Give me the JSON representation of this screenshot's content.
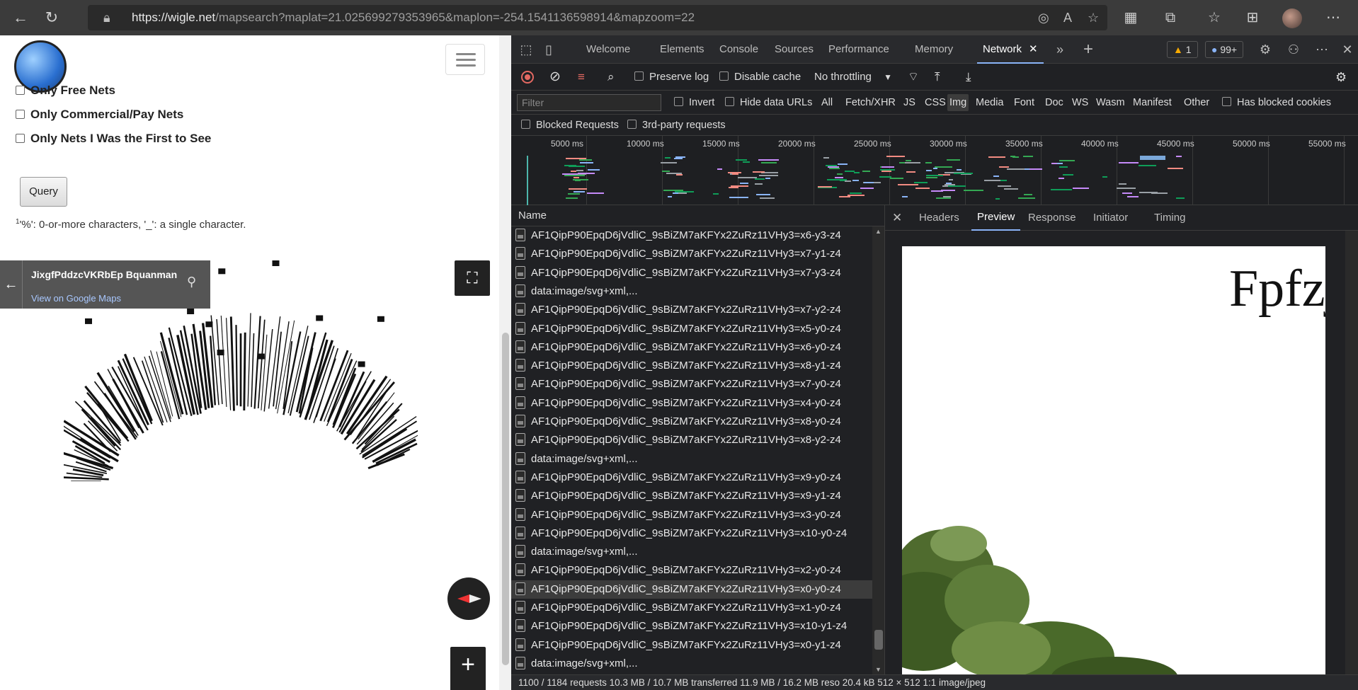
{
  "browser": {
    "url_host": "https://wigle.net",
    "url_path": "/mapsearch?maplat=21.025699279353965&maplon=-254.1541136598914&mapzoom=22",
    "icons": [
      "back-arrow-icon",
      "refresh-icon",
      "lock-icon",
      "tracking-icon",
      "read-aloud-icon",
      "favorite-add-icon",
      "collections-icon",
      "extensions-icon",
      "favorites-icon",
      "browser-essentials-icon",
      "profile-avatar",
      "more-icon"
    ]
  },
  "page": {
    "checkboxes": [
      "Only Free Nets",
      "Only Commercial/Pay Nets",
      "Only Nets I Was the First to See"
    ],
    "query_label": "Query",
    "hint_sup": "1",
    "hint": "'%': 0-or-more characters, '_': a single character.",
    "map_card": {
      "title": "JixgfPddzcVKRbEp Bquanman",
      "link": "View on Google Maps"
    },
    "zoom_in": "+"
  },
  "devtools": {
    "tabs": [
      "Welcome",
      "Elements",
      "Console",
      "Sources",
      "Performance",
      "Memory",
      "Network"
    ],
    "active_tab": "Network",
    "warnings": "1",
    "messages": "99+",
    "toolbar": {
      "preserve_log": "Preserve log",
      "disable_cache": "Disable cache",
      "throttling": "No throttling"
    },
    "filter": {
      "placeholder": "Filter",
      "invert": "Invert",
      "hide_data_urls": "Hide data URLs",
      "types": [
        "All",
        "Fetch/XHR",
        "JS",
        "CSS",
        "Img",
        "Media",
        "Font",
        "Doc",
        "WS",
        "Wasm",
        "Manifest",
        "Other"
      ],
      "active_type": "Img",
      "has_blocked_cookies": "Has blocked cookies",
      "blocked_requests": "Blocked Requests",
      "third_party": "3rd-party requests"
    },
    "overview_ticks": [
      "5000 ms",
      "10000 ms",
      "15000 ms",
      "20000 ms",
      "25000 ms",
      "30000 ms",
      "35000 ms",
      "40000 ms",
      "45000 ms",
      "50000 ms",
      "55000 ms"
    ],
    "name_header": "Name",
    "requests": [
      "AF1QipP90EpqD6jVdliC_9sBiZM7aKFYx2ZuRz11VHy3=x6-y3-z4",
      "AF1QipP90EpqD6jVdliC_9sBiZM7aKFYx2ZuRz11VHy3=x7-y1-z4",
      "AF1QipP90EpqD6jVdliC_9sBiZM7aKFYx2ZuRz11VHy3=x7-y3-z4",
      "data:image/svg+xml,...",
      "AF1QipP90EpqD6jVdliC_9sBiZM7aKFYx2ZuRz11VHy3=x7-y2-z4",
      "AF1QipP90EpqD6jVdliC_9sBiZM7aKFYx2ZuRz11VHy3=x5-y0-z4",
      "AF1QipP90EpqD6jVdliC_9sBiZM7aKFYx2ZuRz11VHy3=x6-y0-z4",
      "AF1QipP90EpqD6jVdliC_9sBiZM7aKFYx2ZuRz11VHy3=x8-y1-z4",
      "AF1QipP90EpqD6jVdliC_9sBiZM7aKFYx2ZuRz11VHy3=x7-y0-z4",
      "AF1QipP90EpqD6jVdliC_9sBiZM7aKFYx2ZuRz11VHy3=x4-y0-z4",
      "AF1QipP90EpqD6jVdliC_9sBiZM7aKFYx2ZuRz11VHy3=x8-y0-z4",
      "AF1QipP90EpqD6jVdliC_9sBiZM7aKFYx2ZuRz11VHy3=x8-y2-z4",
      "data:image/svg+xml,...",
      "AF1QipP90EpqD6jVdliC_9sBiZM7aKFYx2ZuRz11VHy3=x9-y0-z4",
      "AF1QipP90EpqD6jVdliC_9sBiZM7aKFYx2ZuRz11VHy3=x9-y1-z4",
      "AF1QipP90EpqD6jVdliC_9sBiZM7aKFYx2ZuRz11VHy3=x3-y0-z4",
      "AF1QipP90EpqD6jVdliC_9sBiZM7aKFYx2ZuRz11VHy3=x10-y0-z4",
      "data:image/svg+xml,...",
      "AF1QipP90EpqD6jVdliC_9sBiZM7aKFYx2ZuRz11VHy3=x2-y0-z4",
      "AF1QipP90EpqD6jVdliC_9sBiZM7aKFYx2ZuRz11VHy3=x0-y0-z4",
      "AF1QipP90EpqD6jVdliC_9sBiZM7aKFYx2ZuRz11VHy3=x1-y0-z4",
      "AF1QipP90EpqD6jVdliC_9sBiZM7aKFYx2ZuRz11VHy3=x10-y1-z4",
      "AF1QipP90EpqD6jVdliC_9sBiZM7aKFYx2ZuRz11VHy3=x0-y1-z4",
      "data:image/svg+xml,..."
    ],
    "selected_request_index": 19,
    "status_text": "1100 / 1184 requests  10.3 MB / 10.7 MB transferred  11.9 MB / 16.2 MB reso   20.4 kB  512 × 512  1:1  image/jpeg",
    "detail_tabs": [
      "Headers",
      "Preview",
      "Response",
      "Initiator",
      "Timing"
    ],
    "active_detail_tab": "Preview",
    "preview_text": "Fpfzj"
  },
  "colors": {
    "accent": "#8ab4f8",
    "record": "#e46962"
  }
}
